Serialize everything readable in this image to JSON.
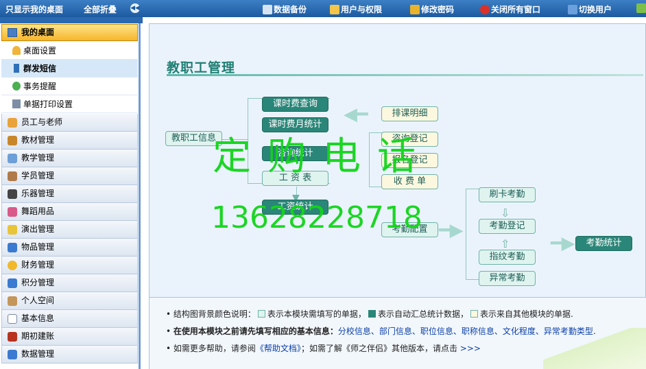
{
  "topbar": {
    "show_desktop": "只显示我的桌面",
    "collapse_all": "全部折叠",
    "backup": "数据备份",
    "users": "用户与权限",
    "password": "修改密码",
    "close_all": "关闭所有窗口",
    "switch_user": "切换用户"
  },
  "sidebar": {
    "header": "我的桌面",
    "subitems": [
      "桌面设置",
      "群发短信",
      "事务提醒",
      "单据打印设置"
    ],
    "categories": [
      "员工与老师",
      "教材管理",
      "教学管理",
      "学员管理",
      "乐器管理",
      "舞蹈用品",
      "演出管理",
      "物品管理",
      "财务管理",
      "积分管理",
      "个人空间",
      "基本信息",
      "期初建账",
      "数据管理"
    ]
  },
  "main": {
    "title": "教职工管理",
    "nodes": {
      "staff_info": "教职工信息",
      "fee_query": "课时费查询",
      "fee_monthly": "课时费月统计",
      "consult_stats": "咨询统计",
      "salary_table": "工 资 表",
      "salary_stats": "工资统计",
      "schedule": "排课明细",
      "consult_reg": "咨询登记",
      "signup_reg": "报名登记",
      "receipt": "收 费 单",
      "attend_config": "考勤配置",
      "card_attend": "刷卡考勤",
      "attend_reg": "考勤登记",
      "finger_attend": "指纹考勤",
      "abnormal_attend": "异常考勤",
      "attend_stats": "考勤统计"
    },
    "watermark_text": "定购电话",
    "watermark_phone": "13628228718"
  },
  "legend": {
    "row1_prefix": "结构图背景颜色说明：",
    "row1_a": "表示本模块需填写的单据，",
    "row1_b": "表示自动汇总统计数据，",
    "row1_c": "表示来自其他模块的单据.",
    "row2_prefix": "在使用本模块之前请先填写相应的基本信息：",
    "row2_links": "分校信息、部门信息、职位信息、职称信息、文化程度、异常考勤类型",
    "row2_end": ".",
    "row3_a": "如需更多帮助，请参阅",
    "row3_link": "《帮助文档》",
    "row3_b": "；如需了解《师之伴侣》其他版本，请点击",
    "row3_more": ">>>"
  },
  "colors": {
    "accent": "#2a8678",
    "watermark": "#12d41a",
    "topbar": "#1c5aa0"
  }
}
